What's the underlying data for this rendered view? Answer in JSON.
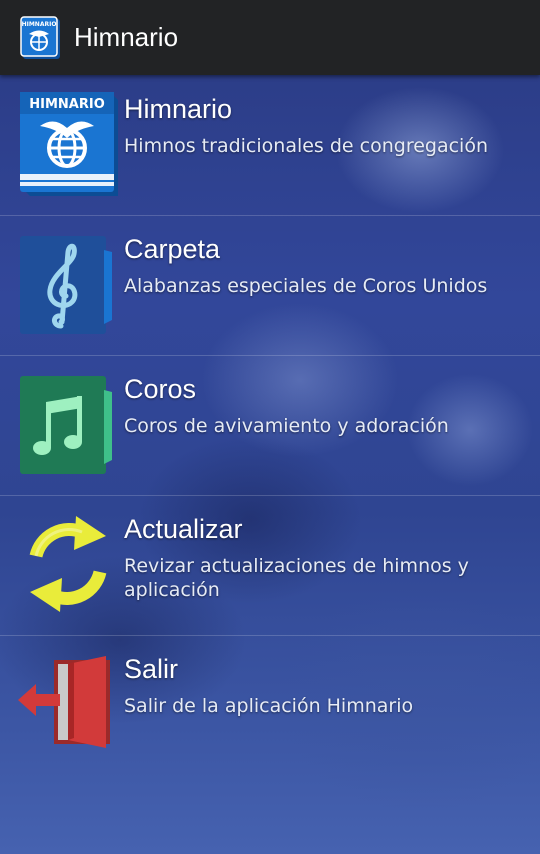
{
  "app": {
    "title": "Himnario",
    "icon": "himnario-book-icon",
    "icon_label": "HIMNARIO"
  },
  "menu": [
    {
      "title": "Himnario",
      "subtitle": "Himnos tradicionales de congregación",
      "icon": "himnario-book-icon",
      "icon_label": "HIMNARIO"
    },
    {
      "title": "Carpeta",
      "subtitle": "Alabanzas especiales de Coros Unidos",
      "icon": "treble-clef-folder-icon"
    },
    {
      "title": "Coros",
      "subtitle": "Coros de avivamiento y adoración",
      "icon": "music-note-folder-icon"
    },
    {
      "title": "Actualizar",
      "subtitle": "Revizar actualizaciones de himnos y aplicación",
      "icon": "refresh-arrows-icon"
    },
    {
      "title": "Salir",
      "subtitle": "Salir de la aplicación Himnario",
      "icon": "exit-door-icon"
    }
  ],
  "colors": {
    "action_bar": "#222325",
    "background": "#2b3f86",
    "himnario_blue": "#1a75d2",
    "carpeta_blue": "#1f4f9a",
    "coros_green": "#1f7a55",
    "refresh_yellow": "#e9ec3a",
    "salir_red": "#d23a3a"
  }
}
